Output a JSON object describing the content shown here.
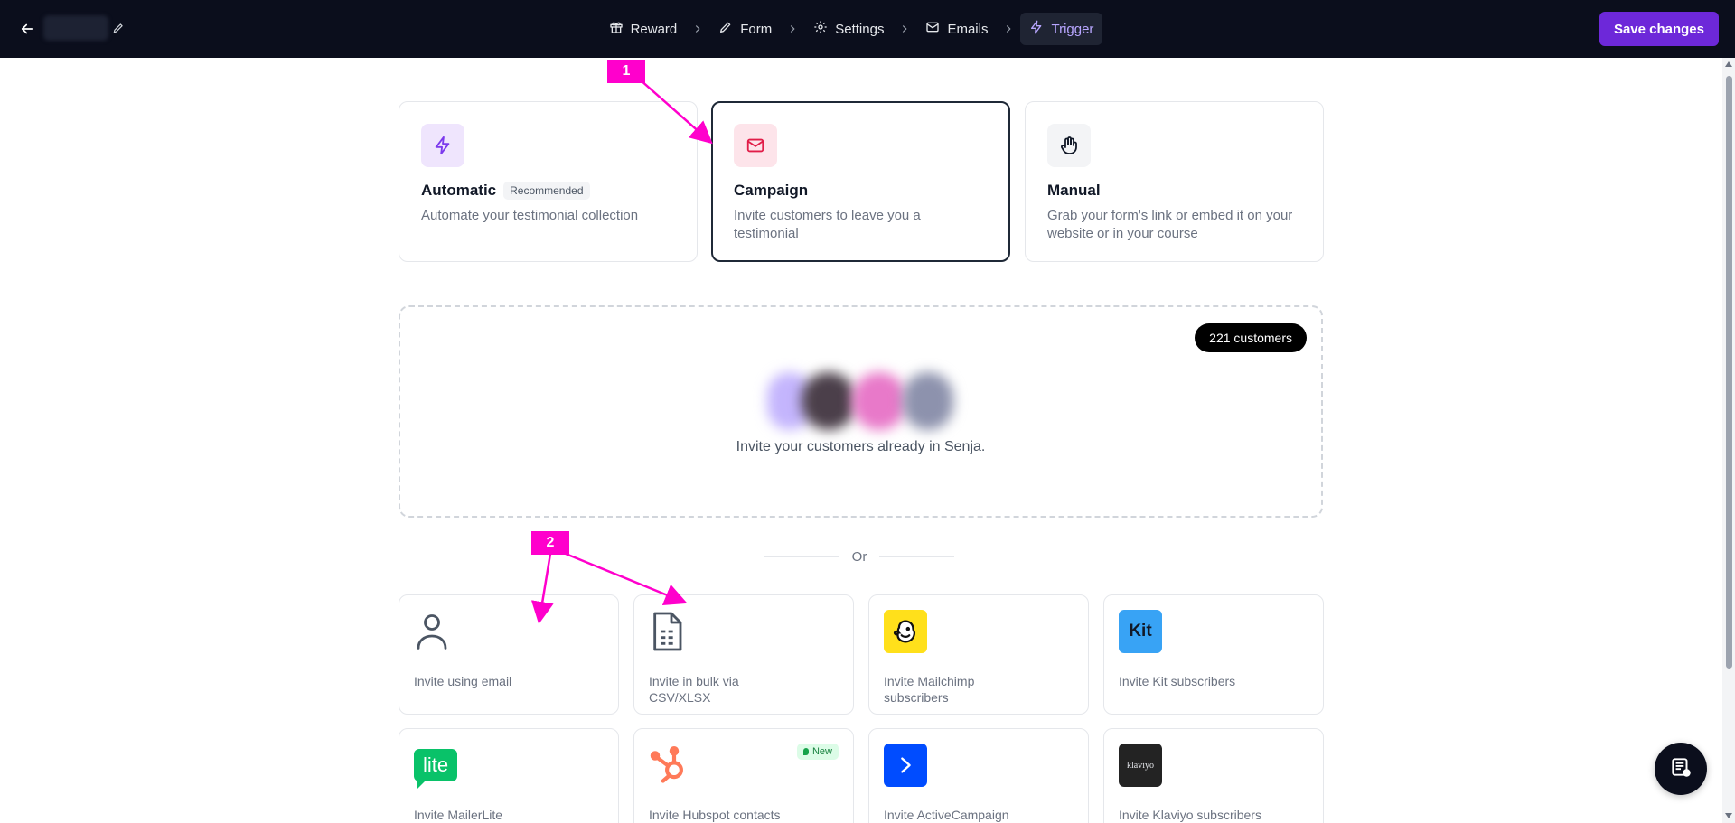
{
  "topbar": {
    "steps": [
      {
        "label": "Reward",
        "icon": "gift-icon"
      },
      {
        "label": "Form",
        "icon": "pencil-icon"
      },
      {
        "label": "Settings",
        "icon": "gear-icon"
      },
      {
        "label": "Emails",
        "icon": "mail-icon"
      },
      {
        "label": "Trigger",
        "icon": "bolt-icon",
        "active": true
      }
    ],
    "save_label": "Save changes"
  },
  "trigger_options": [
    {
      "title": "Automatic",
      "badge": "Recommended",
      "description": "Automate your testimonial collection",
      "icon": "bolt-icon",
      "icon_bg": "#efe5fd",
      "icon_color": "#7c3aed"
    },
    {
      "title": "Campaign",
      "description": "Invite customers to leave you a testimonial",
      "icon": "mail-icon",
      "icon_bg": "#fde4ea",
      "icon_color": "#e11d48",
      "selected": true
    },
    {
      "title": "Manual",
      "description": "Grab your form's link or embed it on your website or in your course",
      "icon": "hand-icon",
      "icon_bg": "#f3f4f6",
      "icon_color": "#111827"
    }
  ],
  "customers": {
    "count_label": "221 customers",
    "invite_text": "Invite your customers already in Senja."
  },
  "divider": {
    "label": "Or"
  },
  "invite_options": [
    {
      "label": "Invite using email",
      "icon": "user-icon"
    },
    {
      "label": "Invite in bulk via CSV/XLSX",
      "icon": "file-sheet-icon"
    },
    {
      "label": "Invite Mailchimp subscribers",
      "icon": "mailchimp-icon"
    },
    {
      "label": "Invite Kit subscribers",
      "icon": "kit-icon",
      "icon_text": "Kit"
    },
    {
      "label": "Invite MailerLite subscribers",
      "icon": "mailerlite-icon",
      "icon_text": "lite"
    },
    {
      "label": "Invite Hubspot contacts",
      "icon": "hubspot-icon",
      "badge": "New"
    },
    {
      "label": "Invite ActiveCampaign contacts",
      "icon": "activecampaign-icon"
    },
    {
      "label": "Invite Klaviyo subscribers",
      "icon": "klaviyo-icon",
      "icon_text": "klaviyo"
    }
  ],
  "annotations": [
    "1",
    "2"
  ],
  "colors": {
    "accent": "#6d28d9",
    "annotation": "#ff00cc",
    "topbar": "#0b0e1c"
  }
}
